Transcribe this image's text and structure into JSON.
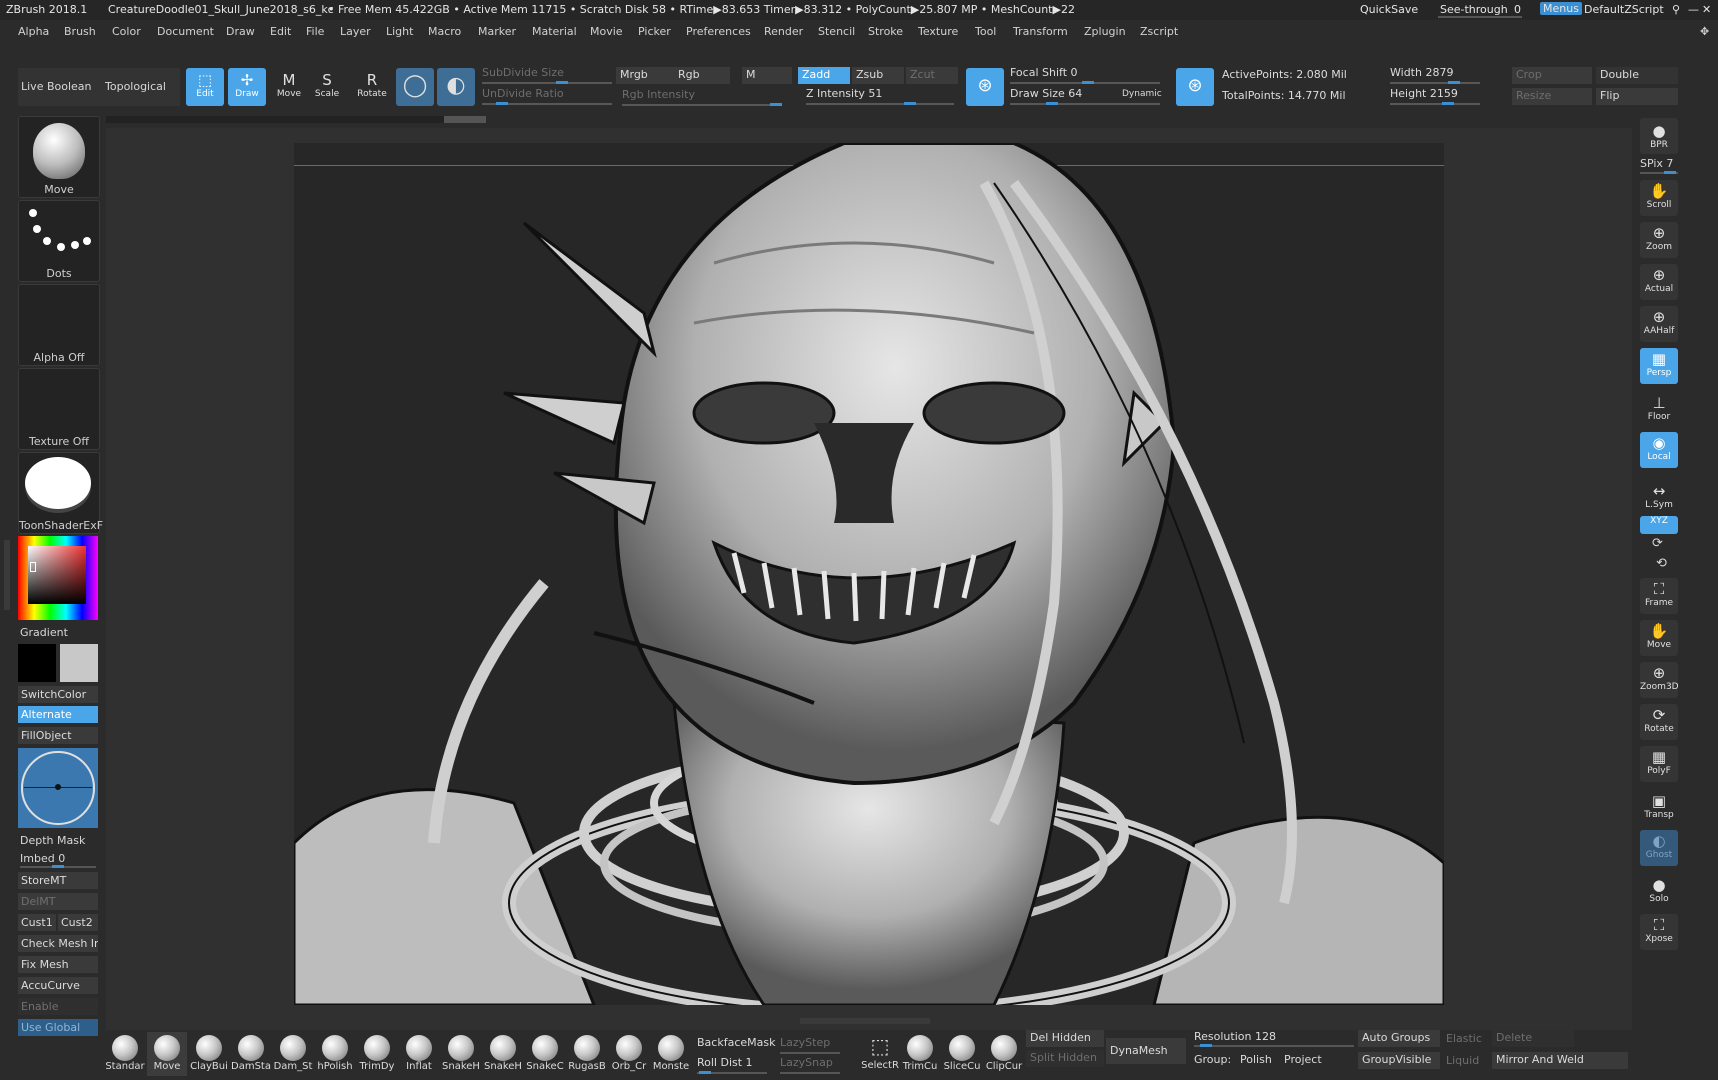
{
  "titlebar": {
    "app": "ZBrush 2018.1",
    "document": "CreatureDoodle01_Skull_June2018_s6_kc",
    "stats": "• Free Mem 45.422GB • Active Mem 11715 • Scratch Disk 58 • RTime▶83.653 Timer▶83.312 • PolyCount▶25.807 MP • MeshCount▶22",
    "quicksave": "QuickSave",
    "seethrough": "See-through",
    "seethrough_value": "0",
    "menus": "Menus",
    "script": "DefaultZScript"
  },
  "menu": [
    "Alpha",
    "Brush",
    "Color",
    "Document",
    "Draw",
    "Edit",
    "File",
    "Layer",
    "Light",
    "Macro",
    "Marker",
    "Material",
    "Movie",
    "Picker",
    "Preferences",
    "Render",
    "Stencil",
    "Stroke",
    "Texture",
    "Tool",
    "Transform",
    "Zplugin",
    "Zscript"
  ],
  "shelf": {
    "live_boolean": "Live Boolean",
    "topological": "Topological",
    "edit": "Edit",
    "draw": "Draw",
    "move": "Move",
    "scale": "Scale",
    "rotate": "Rotate",
    "subdivide_size": "SubDivide Size",
    "undivide_ratio": "UnDivide Ratio",
    "mrgb": "Mrgb",
    "rgb": "Rgb",
    "m": "M",
    "rgb_intensity": "Rgb Intensity",
    "zadd": "Zadd",
    "zsub": "Zsub",
    "zcut": "Zcut",
    "z_intensity": "Z Intensity 51",
    "focal_shift": "Focal Shift 0",
    "draw_size": "Draw Size 64",
    "dynamic": "Dynamic",
    "active_points": "ActivePoints: 2.080 Mil",
    "total_points": "TotalPoints:  14.770 Mil",
    "width": "Width 2879",
    "height": "Height 2159",
    "crop": "Crop",
    "resize": "Resize",
    "double": "Double",
    "flip": "Flip"
  },
  "left": {
    "move": "Move",
    "dots": "Dots",
    "alpha_off": "Alpha Off",
    "texture_off": "Texture Off",
    "material": "ToonShaderExF",
    "gradient": "Gradient",
    "switchcolor": "SwitchColor",
    "alternate": "Alternate",
    "fillobject": "FillObject",
    "depth_mask": "Depth Mask",
    "imbed": "Imbed 0",
    "storemt": "StoreMT",
    "delmt": "DelMT",
    "cust1": "Cust1",
    "cust2": "Cust2",
    "check_mesh": "Check Mesh In",
    "fix_mesh": "Fix Mesh",
    "accucurve": "AccuCurve",
    "enable": "Enable",
    "use_global": "Use Global"
  },
  "right": {
    "bpr": "BPR",
    "spix": "SPix 7",
    "scroll": "Scroll",
    "zoom": "Zoom",
    "actual": "Actual",
    "aahalf": "AAHalf",
    "persp": "Persp",
    "floor": "Floor",
    "local": "Local",
    "lsym": "L.Sym",
    "xyz": "XYZ",
    "frame": "Frame",
    "move": "Move",
    "zoom3d": "Zoom3D",
    "rotate": "Rotate",
    "polyf": "PolyF",
    "transp": "Transp",
    "ghost": "Ghost",
    "solo": "Solo",
    "xpose": "Xpose"
  },
  "brushes": [
    "Standar",
    "Move",
    "ClayBui",
    "DamSta",
    "Dam_St",
    "hPolish",
    "TrimDy",
    "Inflat",
    "SnakeH",
    "SnakeH",
    "SnakeC",
    "RugasB",
    "Orb_Cr",
    "Monste"
  ],
  "bottom": {
    "backface": "BackfaceMask",
    "roll_dist": "Roll Dist 1",
    "lazystep": "LazyStep",
    "lazysnap": "LazySnap",
    "select": "SelectR",
    "trim": "TrimCu",
    "slice": "SliceCu",
    "clip": "ClipCur",
    "del_hidden": "Del Hidden",
    "split_hidden": "Split Hidden",
    "dynamesh": "DynaMesh",
    "resolution": "Resolution 128",
    "group": "Group:",
    "polish": "Polish",
    "project": "Project",
    "auto_groups": "Auto Groups",
    "groupvisible": "GroupVisible",
    "elastic": "Elastic",
    "liquid": "Liquid",
    "delete": "Delete",
    "mirror_weld": "Mirror And Weld"
  }
}
